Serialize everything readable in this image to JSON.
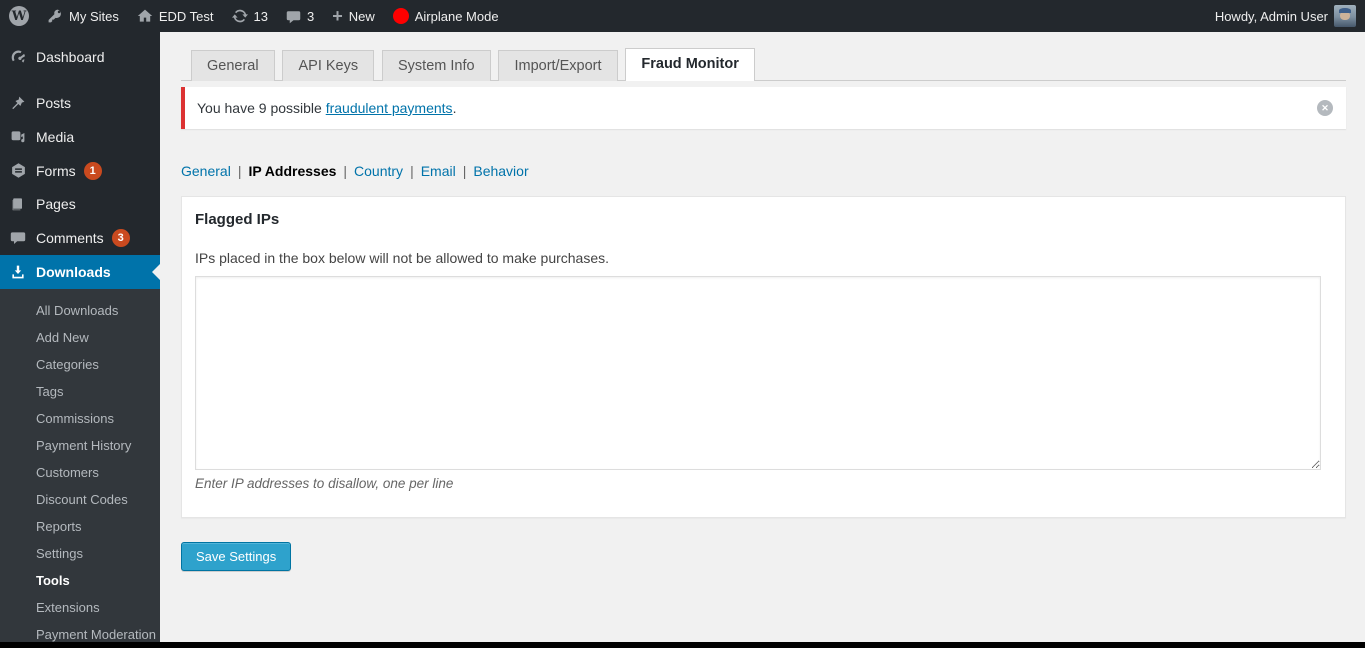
{
  "admin_bar": {
    "logo": "W",
    "my_sites": "My Sites",
    "site_name": "EDD Test",
    "update_count": "13",
    "comment_count": "3",
    "new_label": "New",
    "airplane_mode": "Airplane Mode",
    "howdy": "Howdy, Admin User"
  },
  "sidebar": {
    "items": [
      {
        "label": "Dashboard",
        "icon": "dashboard-icon"
      },
      {
        "label": "Posts",
        "icon": "pin-icon"
      },
      {
        "label": "Media",
        "icon": "media-icon"
      },
      {
        "label": "Forms",
        "icon": "forms-icon",
        "badge": "1"
      },
      {
        "label": "Pages",
        "icon": "pages-icon"
      },
      {
        "label": "Comments",
        "icon": "comments-icon",
        "badge": "3"
      },
      {
        "label": "Downloads",
        "icon": "download-icon",
        "active": true
      }
    ],
    "submenu": [
      "All Downloads",
      "Add New",
      "Categories",
      "Tags",
      "Commissions",
      "Payment History",
      "Customers",
      "Discount Codes",
      "Reports",
      "Settings",
      "Tools",
      "Extensions",
      "Payment Moderation"
    ],
    "current_submenu": "Tools"
  },
  "tabs": [
    {
      "label": "General"
    },
    {
      "label": "API Keys"
    },
    {
      "label": "System Info"
    },
    {
      "label": "Import/Export"
    },
    {
      "label": "Fraud Monitor",
      "active": true
    }
  ],
  "notice": {
    "prefix": "You have 9 possible ",
    "link_text": "fraudulent payments",
    "suffix": "."
  },
  "subnav": {
    "separator": "|",
    "items": [
      {
        "label": "General"
      },
      {
        "label": "IP Addresses",
        "current": true
      },
      {
        "label": "Country"
      },
      {
        "label": "Email"
      },
      {
        "label": "Behavior"
      }
    ]
  },
  "panel": {
    "title": "Flagged IPs",
    "description": "IPs placed in the box below will not be allowed to make purchases.",
    "textarea_value": "",
    "hint": "Enter IP addresses to disallow, one per line"
  },
  "save_button": "Save Settings",
  "colors": {
    "admin_dark": "#23282d",
    "submenu_dark": "#32373c",
    "accent_blue": "#0073aa",
    "notice_red": "#dc3232",
    "badge_orange": "#ca4a1f",
    "button_blue": "#2ea2cc"
  }
}
